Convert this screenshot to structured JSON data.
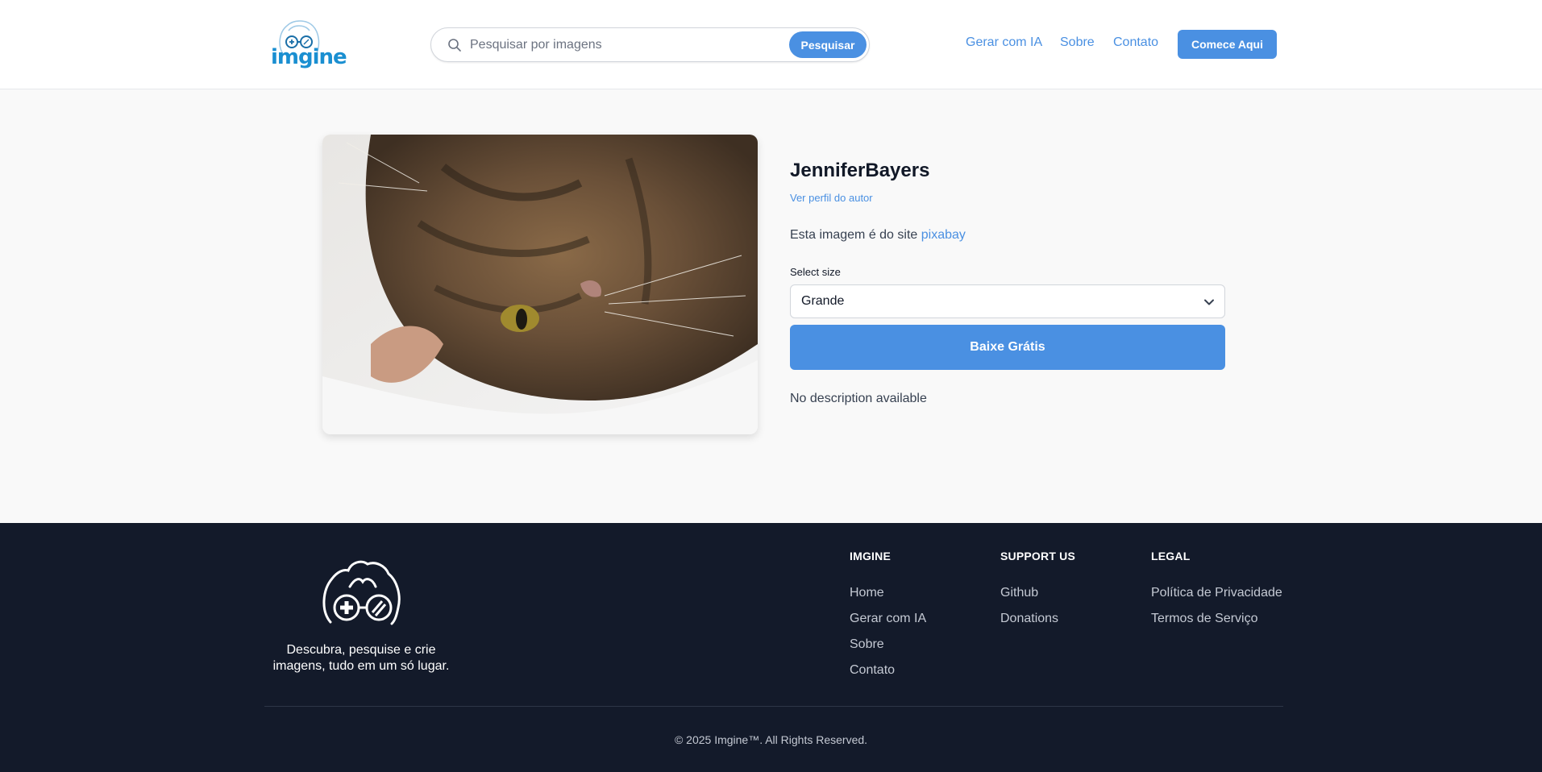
{
  "header": {
    "logo_text": "imgine",
    "search": {
      "placeholder": "Pesquisar por imagens",
      "value": "",
      "button_label": "Pesquisar"
    },
    "nav": [
      "Gerar com IA",
      "Sobre",
      "Contato"
    ],
    "cta_label": "Comece Aqui"
  },
  "image_details": {
    "author": "JenniferBayers",
    "author_link": "Ver perfil do autor",
    "source_prefix": "Esta imagem é do site",
    "source_link": "pixabay",
    "size_label": "Select size",
    "size_selected": "Grande",
    "download_label": "Baixe Grátis",
    "description": "No description available"
  },
  "footer": {
    "tagline": "Descubra, pesquise e crie imagens, tudo em um só lugar.",
    "columns": [
      {
        "heading": "IMGINE",
        "links": [
          "Home",
          "Gerar com IA",
          "Sobre",
          "Contato"
        ]
      },
      {
        "heading": "SUPPORT US",
        "links": [
          "Github",
          "Donations"
        ]
      },
      {
        "heading": "LEGAL",
        "links": [
          "Política de Privacidade",
          "Termos de Serviço"
        ]
      }
    ],
    "copyright": "© 2025 Imgine™. All Rights Reserved."
  },
  "colors": {
    "accent": "#4a90e2",
    "logo_blue": "#1a8fd1",
    "footer_bg": "#131a2a",
    "page_bg": "#f9f9f9"
  },
  "icons": [
    "logo-icon",
    "search-icon",
    "chevron-down-icon",
    "footer-logo-icon"
  ]
}
